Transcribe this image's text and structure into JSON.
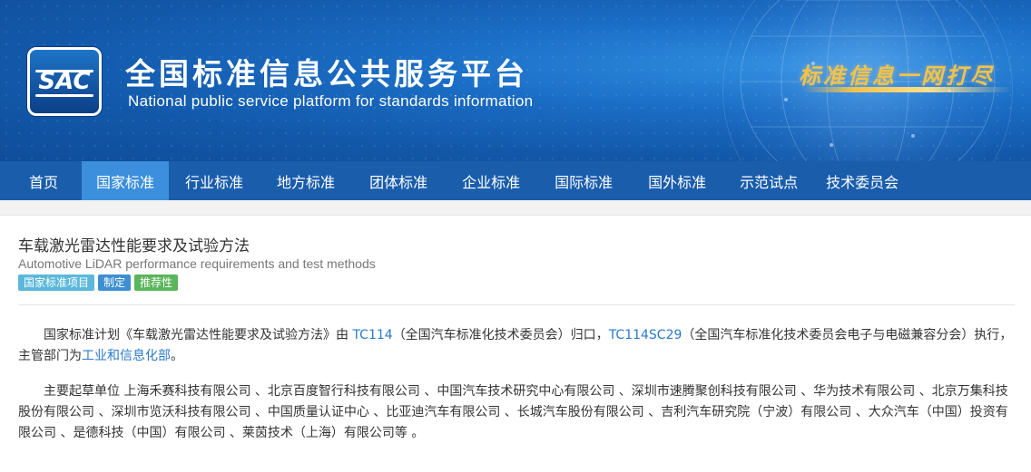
{
  "header": {
    "logo_text": "SAC",
    "title_cn": "全国标准信息公共服务平台",
    "title_en": "National public service platform  for standards information",
    "slogan": "标准信息一网打尽",
    "logo_icon": "sac-logo-icon"
  },
  "nav": {
    "items": [
      {
        "label": "首页",
        "active": false
      },
      {
        "label": "国家标准",
        "active": true
      },
      {
        "label": "行业标准",
        "active": false
      },
      {
        "label": "地方标准",
        "active": false
      },
      {
        "label": "团体标准",
        "active": false
      },
      {
        "label": "企业标准",
        "active": false
      },
      {
        "label": "国际标准",
        "active": false
      },
      {
        "label": "国外标准",
        "active": false
      },
      {
        "label": "示范试点",
        "active": false
      },
      {
        "label": "技术委员会",
        "active": false
      }
    ],
    "bg_color": "#1a5dab",
    "active_color": "#3b8fdc"
  },
  "project": {
    "title": "车载激光雷达性能要求及试验方法",
    "subtitle": "Automotive LiDAR performance requirements and test methods",
    "tags": [
      {
        "label": "国家标准项目",
        "color": "#5bb8db"
      },
      {
        "label": "制定",
        "color": "#3e8fd0"
      },
      {
        "label": "推荐性",
        "color": "#5bb55b"
      }
    ],
    "para1": {
      "t1": "国家标准计划《车载激光雷达性能要求及试验方法》由 ",
      "link1": "TC114",
      "t2": "（全国汽车标准化技术委员会）归口，",
      "link2": "TC114SC29",
      "t3": "（全国汽车标准化技术委员会电子与电磁兼容分会）执行，主管部门为",
      "link3": "工业和信息化部",
      "t4": "。"
    },
    "para2": "主要起草单位 上海禾赛科技有限公司 、北京百度智行科技有限公司 、中国汽车技术研究中心有限公司 、深圳市速腾聚创科技有限公司 、华为技术有限公司 、北京万集科技股份有限公司 、深圳市览沃科技有限公司 、中国质量认证中心 、比亚迪汽车有限公司 、长城汽车股份有限公司 、吉利汽车研究院（宁波）有限公司 、大众汽车（中国）投资有限公司 、是德科技（中国）有限公司 、莱茵技术（上海）有限公司等 。"
  },
  "colors": {
    "link": "#2a7ac9",
    "slogan": "#f3c24a"
  }
}
